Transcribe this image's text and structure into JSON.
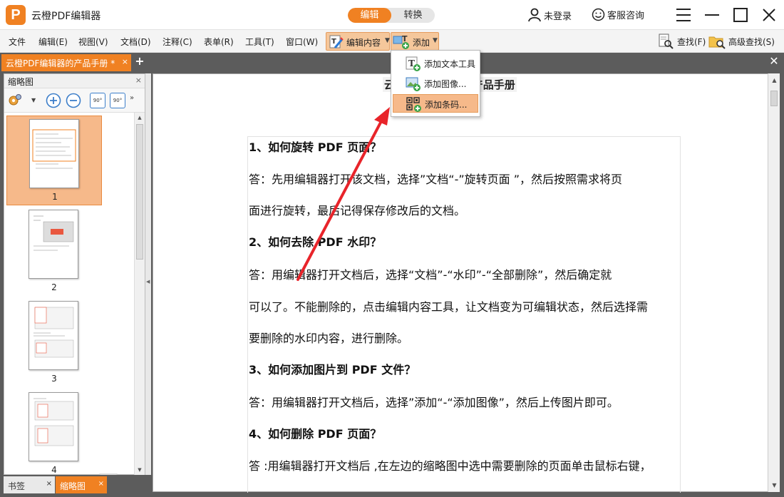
{
  "app": {
    "logo_letter": "P",
    "title": "云橙PDF编辑器",
    "mode_edit": "编辑",
    "mode_convert": "转换",
    "login": "未登录",
    "service": "客服咨询"
  },
  "menu": {
    "items": [
      "文件",
      "编辑(E)",
      "视图(V)",
      "文档(D)",
      "注释(C)",
      "表单(R)",
      "工具(T)",
      "窗口(W)"
    ],
    "edit_content": "编辑内容",
    "add": "添加",
    "find": "查找(F)",
    "advanced_find": "高级查找(S)"
  },
  "tabs": {
    "doc_tab": "云橙PDF编辑器的产品手册 *",
    "close": "×"
  },
  "dropdown": {
    "items": [
      "添加文本工具",
      "添加图像...",
      "添加条码..."
    ]
  },
  "thumbnails": {
    "header": "缩略图",
    "pages": [
      "1",
      "2",
      "3",
      "4"
    ],
    "rotate_left": "90°",
    "rotate_right": "90°"
  },
  "bottom_tabs": {
    "bookmark": "书签",
    "thumbs": "缩略图"
  },
  "document": {
    "title": "云橙PDF编辑器的产品手册",
    "paragraphs": [
      "1、如何旋转 PDF 页面？",
      "答：先用编辑器打开该文档，选择”文档“-”旋转页面 ”，然后按照需求将页",
      "面进行旋转，最后记得保存修改后的文档。",
      "2、如何去除 PDF 水印？",
      "答：用编辑器打开文档后，选择“文档”-“水印”-“全部删除”，然后确定就",
      "可以了。不能删除的，点击编辑内容工具，让文档变为可编辑状态，然后选择需",
      "要删除的水印内容，进行删除。",
      "3、如何添加图片到 PDF 文件？",
      "答：用编辑器打开文档后，选择”添加“-“添加图像”，然后上传图片即可。",
      "4、如何删除 PDF 页面？",
      "答 :用编辑器打开文档后 ,在左边的缩略图中选中需要删除的页面单击鼠标右键，"
    ]
  },
  "colors": {
    "accent": "#f08122",
    "highlight": "#f6b98a",
    "panel_bg": "#5c5c5c",
    "arrow": "#e8242a"
  }
}
